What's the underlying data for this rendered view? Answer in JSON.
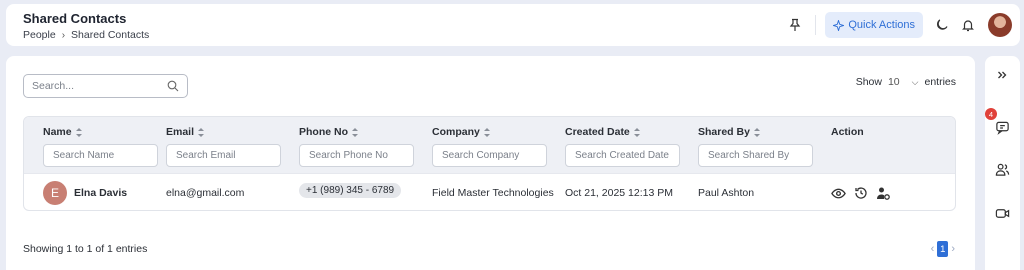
{
  "header": {
    "title": "Shared Contacts",
    "breadcrumb": [
      "People",
      "Shared Contacts"
    ],
    "quick_actions_label": "Quick Actions"
  },
  "search": {
    "placeholder": "Search..."
  },
  "show_entries": {
    "label_before": "Show",
    "value": "10",
    "label_after": "entries"
  },
  "table": {
    "columns": [
      {
        "label": "Name",
        "filter_placeholder": "Search Name"
      },
      {
        "label": "Email",
        "filter_placeholder": "Search Email"
      },
      {
        "label": "Phone No",
        "filter_placeholder": "Search Phone No"
      },
      {
        "label": "Company",
        "filter_placeholder": "Search Company"
      },
      {
        "label": "Created Date",
        "filter_placeholder": "Search Created Date"
      },
      {
        "label": "Shared By",
        "filter_placeholder": "Search Shared By"
      },
      {
        "label": "Action"
      }
    ],
    "rows": [
      {
        "initial": "E",
        "name": "Elna Davis",
        "email": "elna@gmail.com",
        "phone": "+1 (989) 345 - 6789",
        "company": "Field Master Technologies",
        "created_date": "Oct 21, 2025 12:13 PM",
        "shared_by": "Paul Ashton"
      }
    ]
  },
  "footer": {
    "showing": "Showing 1 to 1 of 1 entries",
    "current_page": "1"
  },
  "rail": {
    "notification_count": "4"
  },
  "colors": {
    "accent": "#2f6fd6",
    "avatar_bg": "#c87f73",
    "badge": "#e0413a"
  }
}
